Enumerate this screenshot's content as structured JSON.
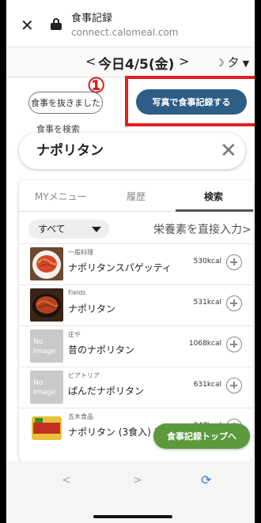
{
  "browser": {
    "close_glyph": "✕",
    "title": "食事記録",
    "url": "connect.calomeal.com"
  },
  "date_bar": {
    "prev_glyph": "<",
    "date": "今日4/5(金)",
    "next_glyph": ">",
    "meal_icon": "moon-icon",
    "meal_label": "夕",
    "meal_caret": "▼"
  },
  "actions": {
    "marker": "①",
    "skip_label": "食事を抜きました",
    "photo_label": "写真で食事記録する",
    "highlight_color": "#e02020"
  },
  "search": {
    "label": "食事を検索",
    "value": "ナポリタン",
    "clear_glyph": "✕"
  },
  "tabs": [
    {
      "label": "MYメニュー",
      "active": false
    },
    {
      "label": "履歴",
      "active": false
    },
    {
      "label": "検索",
      "active": true
    }
  ],
  "filter": {
    "selected": "すべて",
    "direct_input": "栄養素を直接入力>"
  },
  "results": [
    {
      "brand": "一般料理",
      "name": "ナポリタンスパゲッティ",
      "kcal": "530kcal",
      "image": "photo"
    },
    {
      "brand": "Fields",
      "name": "ナポリタン",
      "kcal": "531kcal",
      "image": "photo"
    },
    {
      "brand": "庄や",
      "name": "昔のナポリタン",
      "kcal": "1068kcal",
      "image": "none",
      "no_image_text": "No Image"
    },
    {
      "brand": "ビアトリア",
      "name": "ぱんだナポリタン",
      "kcal": "631kcal",
      "image": "none",
      "no_image_text": "No Image"
    },
    {
      "brand": "五木食品",
      "name": "ナポリタン (3食入) 1食",
      "kcal": "247kcal",
      "image": "package"
    }
  ],
  "floating": {
    "top_label": "食事記録トップへ"
  },
  "bottom_nav": {
    "back_glyph": "<",
    "forward_glyph": ">",
    "reload_glyph": "⟳"
  },
  "colors": {
    "primary_button": "#2e5e86",
    "floating_button": "#5a9a3c",
    "marker": "#d91a1a"
  }
}
